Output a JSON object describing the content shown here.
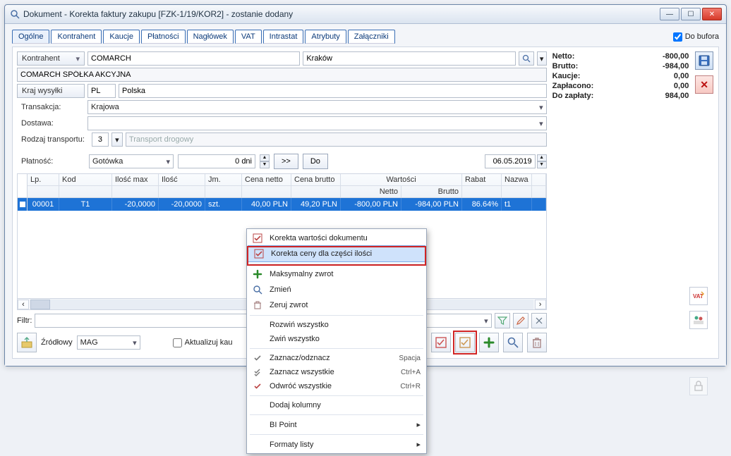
{
  "title": "Dokument - Korekta faktury zakupu [FZK-1/19/KOR2]  - zostanie dodany",
  "do_bufora": "Do bufora",
  "tabs": [
    "Ogólne",
    "Kontrahent",
    "Kaucje",
    "Płatności",
    "Nagłówek",
    "VAT",
    "Intrastat",
    "Atrybuty",
    "Załączniki"
  ],
  "kontrahent_label": "Kontrahent",
  "kontrahent_name": "COMARCH",
  "kontrahent_city": "Kraków",
  "kontrahent_full": "COMARCH SPÓŁKA AKCYJNA",
  "kraj_label": "Kraj wysyłki",
  "kraj_code": "PL",
  "kraj_name": "Polska",
  "transakcja_label": "Transakcja:",
  "transakcja_value": "Krajowa",
  "dostawa_label": "Dostawa:",
  "dostawa_value": "",
  "rodzaj_label": "Rodzaj transportu:",
  "rodzaj_code": "3",
  "rodzaj_name": "Transport drogowy",
  "platnosc_label": "Płatność:",
  "platnosc_value": "Gotówka",
  "platnosc_dni": "0 dni",
  "btn_next": ">>",
  "btn_do": "Do",
  "date": "06.05.2019",
  "totals": {
    "netto_l": "Netto:",
    "netto_v": "-800,00",
    "brutto_l": "Brutto:",
    "brutto_v": "-984,00",
    "kaucje_l": "Kaucje:",
    "kaucje_v": "0,00",
    "zaplacono_l": "Zapłacono:",
    "zaplacono_v": "0,00",
    "dozaplaty_l": "Do zapłaty:",
    "dozaplaty_v": "984,00"
  },
  "grid": {
    "h_lp": "Lp.",
    "h_kod": "Kod",
    "h_imax": "Ilość max",
    "h_ilosc": "Ilość",
    "h_jm": "Jm.",
    "h_cn": "Cena netto",
    "h_cb": "Cena brutto",
    "h_wartosci": "Wartości",
    "h_wn": "Netto",
    "h_wb": "Brutto",
    "h_rabat": "Rabat",
    "h_nazwa": "Nazwa",
    "row": {
      "lp": "00001",
      "kod": "T1",
      "imax": "-20,0000",
      "ilosc": "-20,0000",
      "jm": "szt.",
      "cn": "40,00 PLN",
      "cb": "49,20 PLN",
      "wn": "-800,00 PLN",
      "wb": "-984,00 PLN",
      "rabat": "86.64%",
      "nazwa": "t1"
    }
  },
  "filtr_label": "Filtr:",
  "zrodlowy_label": "Źródłowy",
  "mag_value": "MAG",
  "aktualizuj_label": "Aktualizuj kau",
  "ctx": {
    "korekta_wart": "Korekta wartości dokumentu",
    "korekta_ceny": "Korekta ceny dla części ilości",
    "maks_zwrot": "Maksymalny zwrot",
    "zmien": "Zmień",
    "zeruj": "Zeruj zwrot",
    "rozwin": "Rozwiń wszystko",
    "zwin": "Zwiń wszystko",
    "zaznacz": "Zaznacz/odznacz",
    "zaznacz_sc": "Spacja",
    "zaznacz_w": "Zaznacz wszystkie",
    "zaznacz_w_sc": "Ctrl+A",
    "odwroc": "Odwróć wszystkie",
    "odwroc_sc": "Ctrl+R",
    "dodaj_kol": "Dodaj kolumny",
    "bi": "BI Point",
    "formaty": "Formaty listy"
  }
}
